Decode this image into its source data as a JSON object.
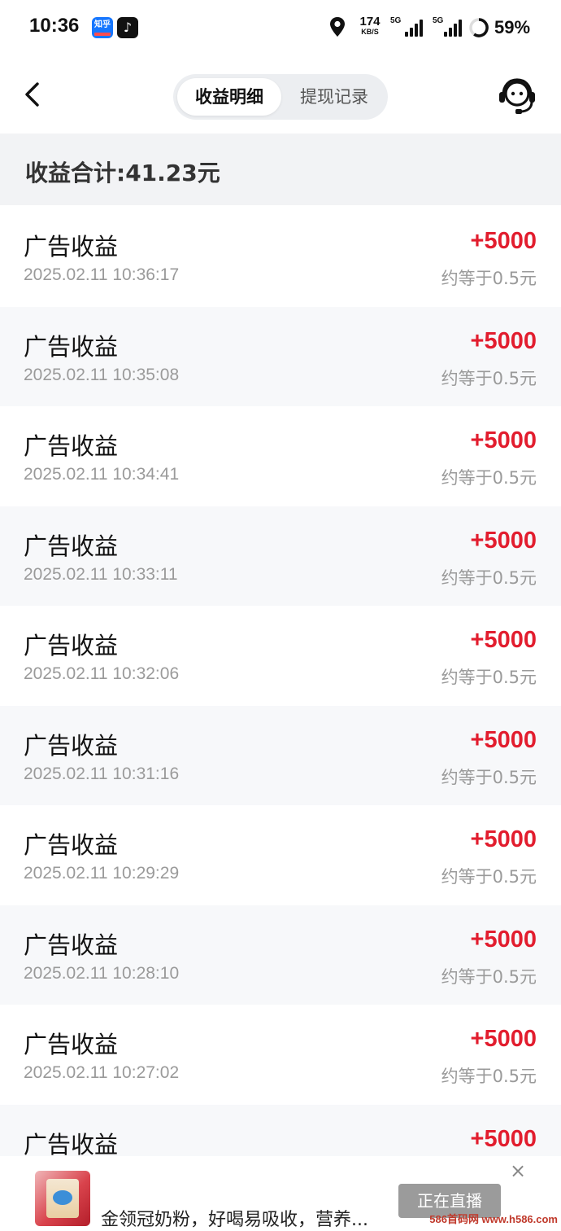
{
  "status_bar": {
    "time": "10:36",
    "app1_label": "知乎",
    "app2_label": "♪",
    "net_speed": "174",
    "net_unit": "KB/S",
    "sim1": "5G",
    "sim2": "5G",
    "battery": "59%",
    "icons": [
      "zhihu-app-icon",
      "douyin-app-icon",
      "location-icon",
      "signal-icon",
      "battery-ring-icon"
    ]
  },
  "header": {
    "tabs": [
      {
        "label": "收益明细",
        "active": true
      },
      {
        "label": "提现记录",
        "active": false
      }
    ],
    "back_icon": "chevron-left-icon",
    "service_icon": "customer-service-icon"
  },
  "summary": {
    "text": "收益合计:41.23元"
  },
  "records": [
    {
      "title": "广告收益",
      "time": "2025.02.11 10:36:17",
      "amount": "+5000",
      "approx": "约等于0.5元"
    },
    {
      "title": "广告收益",
      "time": "2025.02.11 10:35:08",
      "amount": "+5000",
      "approx": "约等于0.5元"
    },
    {
      "title": "广告收益",
      "time": "2025.02.11 10:34:41",
      "amount": "+5000",
      "approx": "约等于0.5元"
    },
    {
      "title": "广告收益",
      "time": "2025.02.11 10:33:11",
      "amount": "+5000",
      "approx": "约等于0.5元"
    },
    {
      "title": "广告收益",
      "time": "2025.02.11 10:32:06",
      "amount": "+5000",
      "approx": "约等于0.5元"
    },
    {
      "title": "广告收益",
      "time": "2025.02.11 10:31:16",
      "amount": "+5000",
      "approx": "约等于0.5元"
    },
    {
      "title": "广告收益",
      "time": "2025.02.11 10:29:29",
      "amount": "+5000",
      "approx": "约等于0.5元"
    },
    {
      "title": "广告收益",
      "time": "2025.02.11 10:28:10",
      "amount": "+5000",
      "approx": "约等于0.5元"
    },
    {
      "title": "广告收益",
      "time": "2025.02.11 10:27:02",
      "amount": "+5000",
      "approx": "约等于0.5元"
    },
    {
      "title": "广告收益",
      "time": "",
      "amount": "+5000",
      "approx": ""
    }
  ],
  "ad": {
    "text": "金领冠奶粉，好喝易吸收，营养...",
    "button": "正在直播",
    "close": "×"
  },
  "watermark": "586首码网 www.h586.com",
  "colors": {
    "amount_red": "#e21d2e",
    "summary_bg": "#f2f3f5",
    "row_alt_bg": "#f7f8fa",
    "muted_text": "#9a9a9a"
  }
}
